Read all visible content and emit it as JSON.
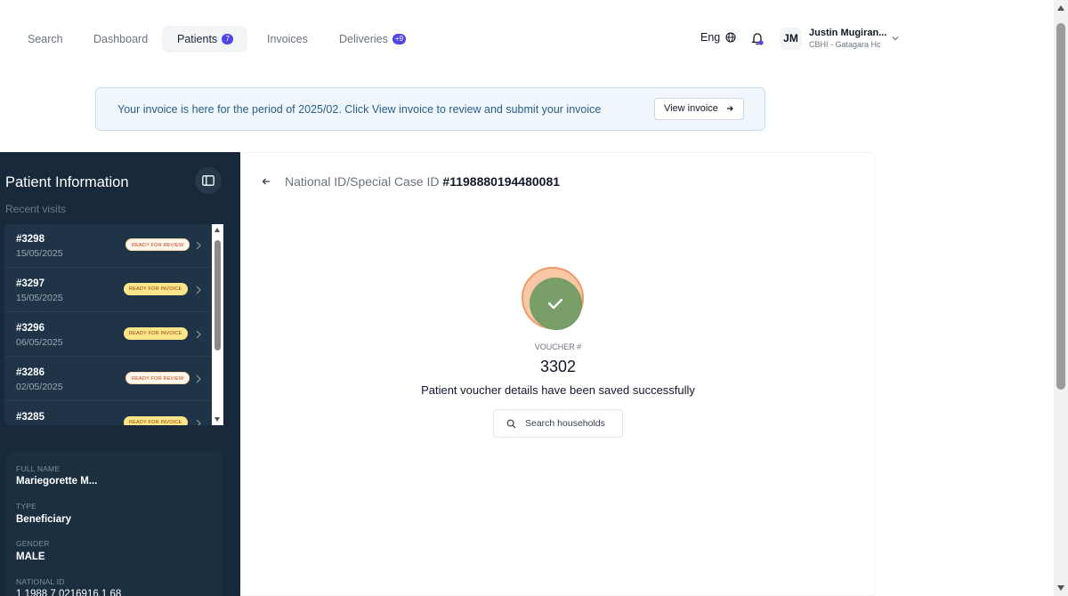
{
  "nav": {
    "search": "Search",
    "dashboard": "Dashboard",
    "patients": "Patients",
    "patients_badge": "7",
    "invoices": "Invoices",
    "deliveries": "Deliveries",
    "deliveries_badge": "+9"
  },
  "header": {
    "language": "Eng",
    "avatar_initials": "JM",
    "user_name": "Justin Mugiran...",
    "user_org": "CBHI - Gatagara Hc",
    "icons": [
      "globe-icon",
      "bell-icon",
      "chevron-down-icon"
    ]
  },
  "banner": {
    "message": "Your invoice is here for the period of 2025/02. Click View invoice to review and submit your invoice",
    "button_label": "View invoice"
  },
  "sidebar": {
    "title": "Patient Information",
    "recent_label": "Recent visits",
    "visits": [
      {
        "id": "#3298",
        "date": "15/05/2025",
        "status": "READY FOR REVIEW"
      },
      {
        "id": "#3297",
        "date": "15/05/2025",
        "status": "READY FOR INVOICE"
      },
      {
        "id": "#3296",
        "date": "06/05/2025",
        "status": "READY FOR INVOICE"
      },
      {
        "id": "#3286",
        "date": "02/05/2025",
        "status": "READY FOR REVIEW"
      },
      {
        "id": "#3285",
        "date": "",
        "status": "READY FOR INVOICE"
      }
    ],
    "info": {
      "full_name_label": "FULL NAME",
      "full_name": "Mariegorette M...",
      "type_label": "TYPE",
      "type": "Beneficiary",
      "gender_label": "GENDER",
      "gender": "MALE",
      "national_id_label": "NATIONAL ID",
      "national_id": "1 1988 7 0216916 1 68"
    }
  },
  "main": {
    "id_prefix": "National ID/Special Case ID",
    "id_value": "#1198880194480081",
    "voucher_label": "VOUCHER #",
    "voucher_number": "3302",
    "success_message": "Patient voucher details have been saved successfully",
    "search_button": "Search households"
  },
  "colors": {
    "accent": "#4f46e5",
    "sidebar_bg": "#17293a",
    "success_green": "#6e9a5e",
    "success_ring": "#f4b48e",
    "banner_bg": "#f0f7fc"
  }
}
